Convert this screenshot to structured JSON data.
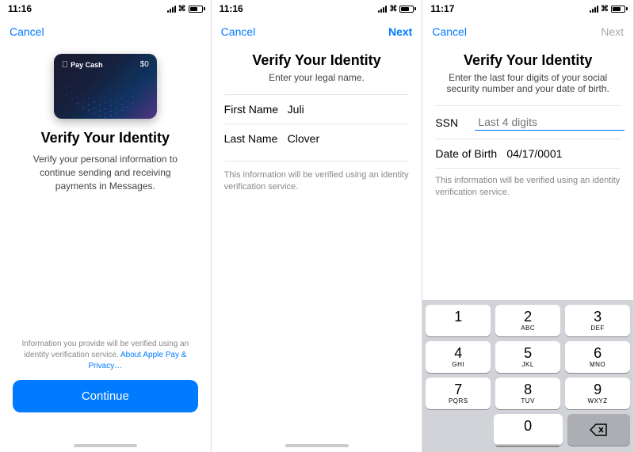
{
  "panel1": {
    "status_time": "11:16",
    "nav_cancel": "Cancel",
    "card_logo": "Pay Cash",
    "card_balance": "$0",
    "title": "Verify Your Identity",
    "subtitle": "Verify your personal information to continue sending and receiving payments in Messages.",
    "footer_text": "Information you provide will be verified using an identity verification service.",
    "footer_link": "About Apple Pay & Privacy…",
    "continue_btn": "Continue"
  },
  "panel2": {
    "status_time": "11:16",
    "nav_cancel": "Cancel",
    "nav_next": "Next",
    "title": "Verify Your Identity",
    "subtitle": "Enter your legal name.",
    "first_name_label": "First Name",
    "first_name_value": "Juli",
    "last_name_label": "Last Name",
    "last_name_value": "Clover",
    "note": "This information will be verified using an identity verification service."
  },
  "panel3": {
    "status_time": "11:17",
    "nav_cancel": "Cancel",
    "nav_next": "Next",
    "title": "Verify Your Identity",
    "subtitle": "Enter the last four digits of your social security number and your date of birth.",
    "ssn_label": "SSN",
    "ssn_placeholder": "Last 4 digits",
    "dob_label": "Date of Birth",
    "dob_value": "04/17/0001",
    "note": "This information will be verified using an identity verification service.",
    "keypad": {
      "keys": [
        {
          "number": "1",
          "letters": ""
        },
        {
          "number": "2",
          "letters": "ABC"
        },
        {
          "number": "3",
          "letters": "DEF"
        },
        {
          "number": "4",
          "letters": "GHI"
        },
        {
          "number": "5",
          "letters": "JKL"
        },
        {
          "number": "6",
          "letters": "MNO"
        },
        {
          "number": "7",
          "letters": "PQRS"
        },
        {
          "number": "8",
          "letters": "TUV"
        },
        {
          "number": "9",
          "letters": "WXYZ"
        },
        {
          "number": "0",
          "letters": ""
        }
      ]
    }
  }
}
